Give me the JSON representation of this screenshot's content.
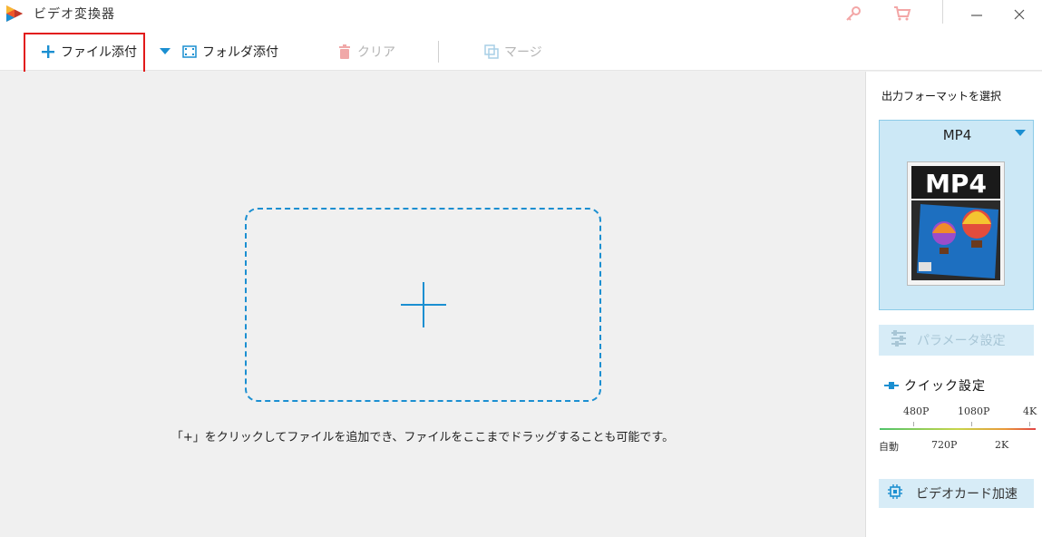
{
  "app": {
    "title": "ビデオ変換器"
  },
  "toolbar": {
    "add_file": "ファイル添付",
    "add_folder": "フォルダ添付",
    "clear": "クリア",
    "merge": "マージ"
  },
  "main": {
    "hint": "「+」をクリックしてファイルを追加でき、ファイルをここまでドラッグすることも可能です。"
  },
  "panel": {
    "title": "出力フォーマットを選択",
    "format_name": "MP4",
    "thumb_text": "MP4",
    "param_button": "パラメータ設定",
    "quick_title": "クイック設定",
    "ticks_top": [
      "480P",
      "1080P",
      "4K"
    ],
    "ticks_bottom": [
      "自動",
      "720P",
      "2K"
    ],
    "gpu_button": "ビデオカード加速"
  },
  "colors": {
    "accent": "#1b8fd1",
    "highlight": "#e21a1a",
    "card": "#cce8f6"
  }
}
